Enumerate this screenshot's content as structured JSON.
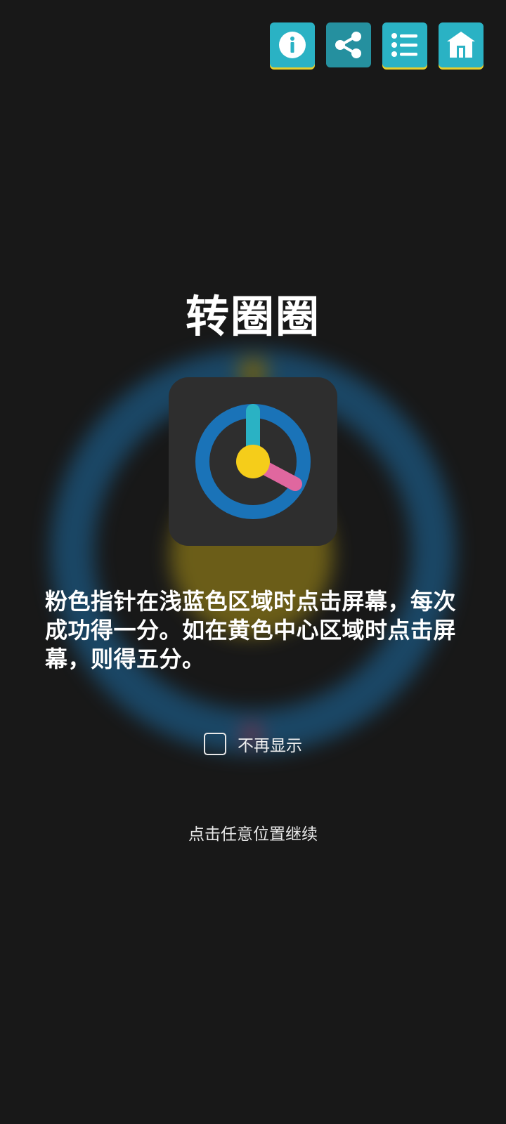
{
  "toolbar": {
    "buttons": [
      {
        "name": "info",
        "icon": "info-icon"
      },
      {
        "name": "share",
        "icon": "share-icon"
      },
      {
        "name": "list",
        "icon": "list-icon"
      },
      {
        "name": "home",
        "icon": "home-icon"
      }
    ]
  },
  "title": "转圈圈",
  "app_icon": "clock-dial-icon",
  "description": "粉色指针在浅蓝色区域时点击屏幕，每次成功得一分。如在黄色中心区域时点击屏幕，则得五分。",
  "checkbox": {
    "label": "不再显示",
    "checked": false
  },
  "continue_hint": "点击任意位置继续",
  "colors": {
    "background": "#181818",
    "toolbar_button": "#2ab2c4",
    "toolbar_button_dark": "#25909f",
    "toolbar_accent": "#e7cf2c",
    "ring_blue": "#1a73b8",
    "hand_teal": "#2ab2c4",
    "hand_pink": "#e0679f",
    "center_yellow": "#f5cd1a",
    "icon_tile": "#2e2e2e"
  }
}
